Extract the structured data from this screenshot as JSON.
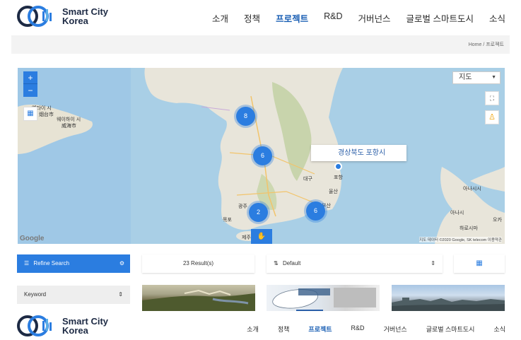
{
  "brand": {
    "line1": "Smart City",
    "line2": "Korea",
    "accent": "#2b7de0"
  },
  "nav": {
    "items": [
      "소개",
      "정책",
      "프로젝트",
      "R&D",
      "거버넌스",
      "글로벌 스마트도시",
      "소식"
    ],
    "active": "프로젝트"
  },
  "breadcrumb": "Home / 프로젝트",
  "map": {
    "zoom_in": "+",
    "zoom_out": "−",
    "map_type": "지도",
    "provider_logo": "Google",
    "copyright": "지도 데이터 ©2020 Google, SK telecom   이용약관",
    "infobox": "경상북도 포항시",
    "clusters": [
      "8",
      "6",
      "2",
      "6"
    ],
    "labels": [
      "옌타이 시",
      "烟台市",
      "웨이하이 시",
      "威海市",
      "대구",
      "포항",
      "울산",
      "부산",
      "광주",
      "목포",
      "아나시시",
      "아나시",
      "오카",
      "하로시마",
      "제주"
    ]
  },
  "toolbar": {
    "refine_label": "Refine Search",
    "results": "23 Result(s)",
    "sort_label": "Default"
  },
  "filters": {
    "keyword_label": "Keyword"
  }
}
